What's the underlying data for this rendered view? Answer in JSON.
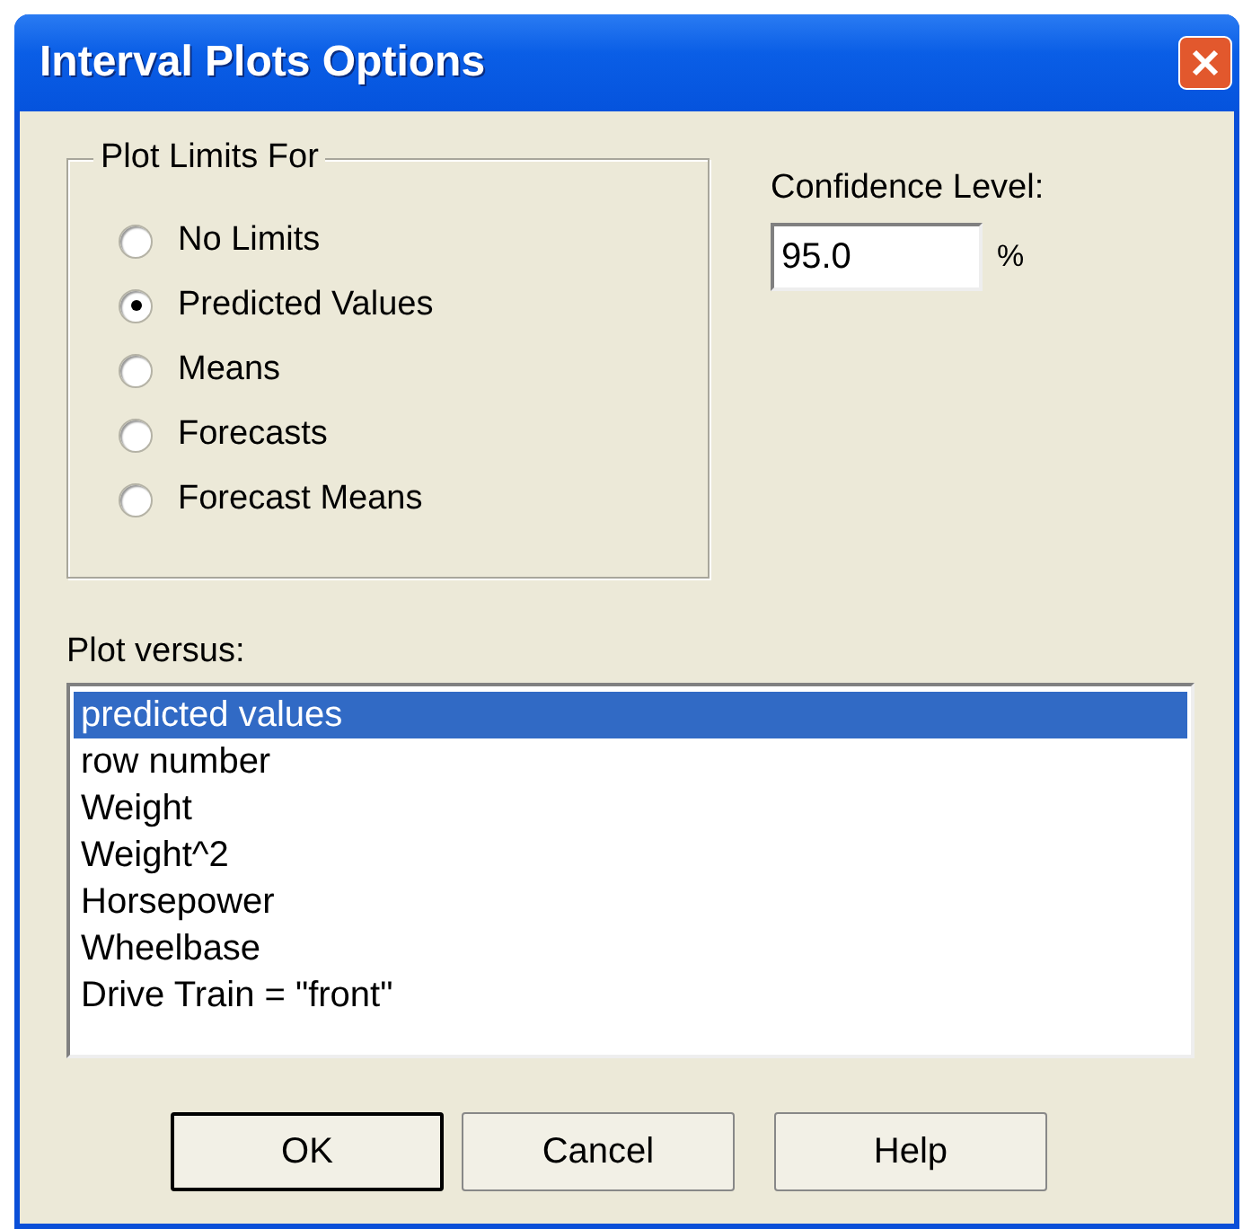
{
  "window": {
    "title": "Interval Plots Options"
  },
  "plot_limits": {
    "title": "Plot Limits For",
    "options": [
      {
        "label": "No Limits",
        "selected": false
      },
      {
        "label": "Predicted Values",
        "selected": true
      },
      {
        "label": "Means",
        "selected": false
      },
      {
        "label": "Forecasts",
        "selected": false
      },
      {
        "label": "Forecast Means",
        "selected": false
      }
    ]
  },
  "confidence": {
    "label": "Confidence Level:",
    "value": "95.0",
    "unit": "%"
  },
  "plot_versus": {
    "label": "Plot versus:",
    "items": [
      {
        "text": "predicted values",
        "selected": true
      },
      {
        "text": "row number",
        "selected": false
      },
      {
        "text": "Weight",
        "selected": false
      },
      {
        "text": "Weight^2",
        "selected": false
      },
      {
        "text": "Horsepower",
        "selected": false
      },
      {
        "text": "Wheelbase",
        "selected": false
      },
      {
        "text": "Drive Train = \"front\"",
        "selected": false
      }
    ]
  },
  "buttons": [
    {
      "label": "OK",
      "default": true
    },
    {
      "label": "Cancel",
      "default": false
    },
    {
      "label": "Help",
      "default": false
    }
  ]
}
